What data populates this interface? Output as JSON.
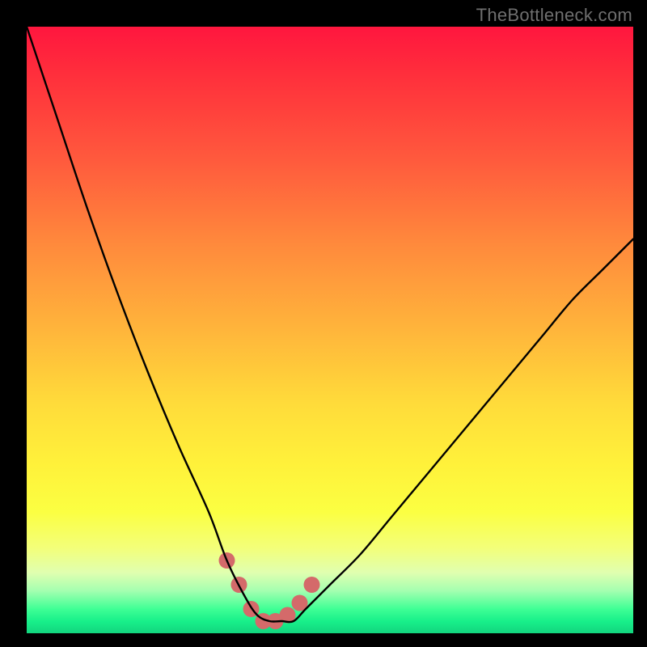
{
  "watermark": {
    "text": "TheBottleneck.com"
  },
  "chart_data": {
    "type": "line",
    "title": "",
    "xlabel": "",
    "ylabel": "",
    "xlim": [
      0,
      100
    ],
    "ylim": [
      0,
      100
    ],
    "grid": false,
    "series": [
      {
        "name": "bottleneck-curve",
        "x": [
          0,
          5,
          10,
          15,
          20,
          25,
          30,
          33,
          36,
          38,
          40,
          42,
          44,
          46,
          50,
          55,
          60,
          65,
          70,
          75,
          80,
          85,
          90,
          95,
          100
        ],
        "values": [
          100,
          85,
          70,
          56,
          43,
          31,
          20,
          12,
          6,
          3,
          2,
          2,
          2,
          4,
          8,
          13,
          19,
          25,
          31,
          37,
          43,
          49,
          55,
          60,
          65
        ]
      }
    ],
    "dip_marker": {
      "x": [
        33,
        35,
        37,
        39,
        41,
        43,
        45,
        47
      ],
      "values": [
        12,
        8,
        4,
        2,
        2,
        3,
        5,
        8
      ],
      "color": "#d46a6a",
      "radius": 10
    },
    "background_gradient": {
      "top": "#ff163e",
      "mid": "#ffdb3a",
      "bottom": "#12d57e"
    }
  }
}
